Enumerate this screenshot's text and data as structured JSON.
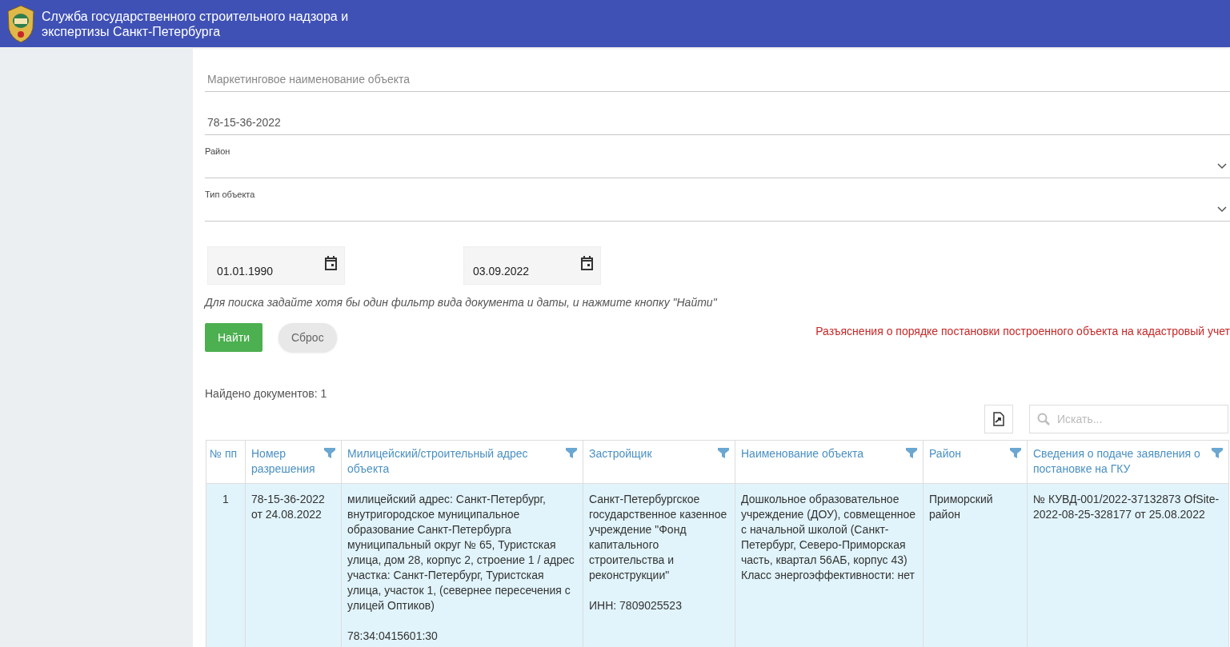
{
  "header": {
    "title": "Служба государственного строительного надзора и экспертизы Санкт-Петербурга"
  },
  "filters": {
    "marketing_name": {
      "placeholder": "Маркетинговое наименование объекта"
    },
    "permit_number": {
      "value": "78-15-36-2022"
    },
    "selects": [
      {
        "label": "Район"
      },
      {
        "label": "Тип объекта"
      }
    ],
    "dates": [
      {
        "value": "01.01.1990"
      },
      {
        "value": "03.09.2022"
      }
    ],
    "hint": "Для поиска задайте хотя бы один фильтр вида документа и даты, и нажмите кнопку \"Найти\"",
    "buttons": [
      {
        "label": "Найти",
        "kind": "primary"
      },
      {
        "label": "Сброс",
        "kind": "secondary"
      }
    ],
    "link": "Разъяснения о порядке постановки построенного объекта на кадастровый учет"
  },
  "results": {
    "count": "Найдено документов: 1",
    "search": {
      "placeholder": "Искать..."
    }
  },
  "table": {
    "columns": [
      {
        "label": "№ пп",
        "filter": false
      },
      {
        "label": "Номер разрешения",
        "filter": true
      },
      {
        "label": "Милицейский/строительный адрес объекта",
        "filter": true
      },
      {
        "label": "Застройщик",
        "filter": true
      },
      {
        "label": "Наименование объекта",
        "filter": true
      },
      {
        "label": "Район",
        "filter": true
      },
      {
        "label": "Сведения о подаче заявления о постановке на ГКУ",
        "filter": true
      }
    ],
    "rows": [
      {
        "selected": true,
        "cells": [
          "1",
          "78-15-36-2022 от 24.08.2022",
          "милицейский адрес: Санкт-Петербург, внутригородское муниципальное образование Санкт-Петербурга муниципальный округ № 65, Туристская улица, дом 28, корпус 2, строение 1 / адрес участка: Санкт-Петербург, Туристская улица, участок 1, (севернее пересечения с улицей Оптиков)\n\n78:34:0415601:30",
          "Санкт-Петербургское государственное казенное учреждение \"Фонд капитального строительства и реконструкции\"\n\nИНН: 7809025523",
          "Дошкольное образовательное учреждение (ДОУ), совмещенное с начальной школой (Санкт-Петербург, Северо-Приморская часть, квартал 56АБ, корпус 43) Класс энергоэффективности: нет",
          "Приморский район",
          "№ КУВД-001/2022-37132873 OfSite-2022-08-25-328177 от 25.08.2022"
        ]
      }
    ]
  }
}
